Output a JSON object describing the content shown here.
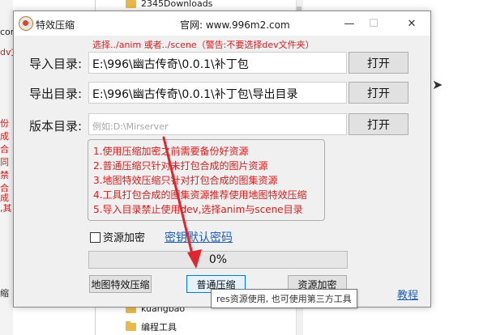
{
  "background": {
    "left_fragments": [
      "con",
      "dv文",
      "份",
      "成",
      "合",
      "同",
      "禁",
      "合",
      "成",
      ",其",
      "缩"
    ],
    "folders_top": [
      "2345Downloads"
    ],
    "folders_bottom": [
      "kuangbao",
      "编程工具"
    ]
  },
  "dialog": {
    "title": "特效压缩",
    "official_site": "官网: www.996m2.com",
    "window_controls": {
      "minimize": "—",
      "maximize": "☐",
      "close": "✕"
    },
    "hint": "选择../anim 或者../scene（警告:不要选择dev文件夹）",
    "import": {
      "label": "导入目录:",
      "value": "E:\\996\\幽古传奇\\0.0.1\\补丁包",
      "button": "打开"
    },
    "export": {
      "label": "导出目录:",
      "value": "E:\\996\\幽古传奇\\0.0.1\\补丁包\\导出目录",
      "button": "打开"
    },
    "version": {
      "label": "版本目录:",
      "placeholder": "例如:D:\\Mirserver",
      "button": "打开"
    },
    "notes": [
      "1.使用压缩加密之前需要备份好资源",
      "2.普通压缩只针对未打包合成的图片资源",
      "3.地图特效压缩只针对打包合成的图集资源",
      "4.工具打包合成的图集资源推荐使用地图特效压缩",
      "5.导入目录禁止使用dev,选择anim与scene目录"
    ],
    "encrypt_checkbox_label": "资源加密",
    "key_link": "密钥默认密码",
    "progress": {
      "text": "0%",
      "value": 0
    },
    "buttons": {
      "map_effect": "地图特效压缩",
      "normal": "普通压缩",
      "encrypt": "资源加密"
    },
    "tutorial_link": "教程"
  },
  "tooltip": "res资源使用, 也可使用第三方工具",
  "colors": {
    "hint_red": "#d81e1e",
    "link_blue": "#1f5fbf",
    "arrow_red": "#e0262c",
    "focus_border": "#0078d7"
  }
}
